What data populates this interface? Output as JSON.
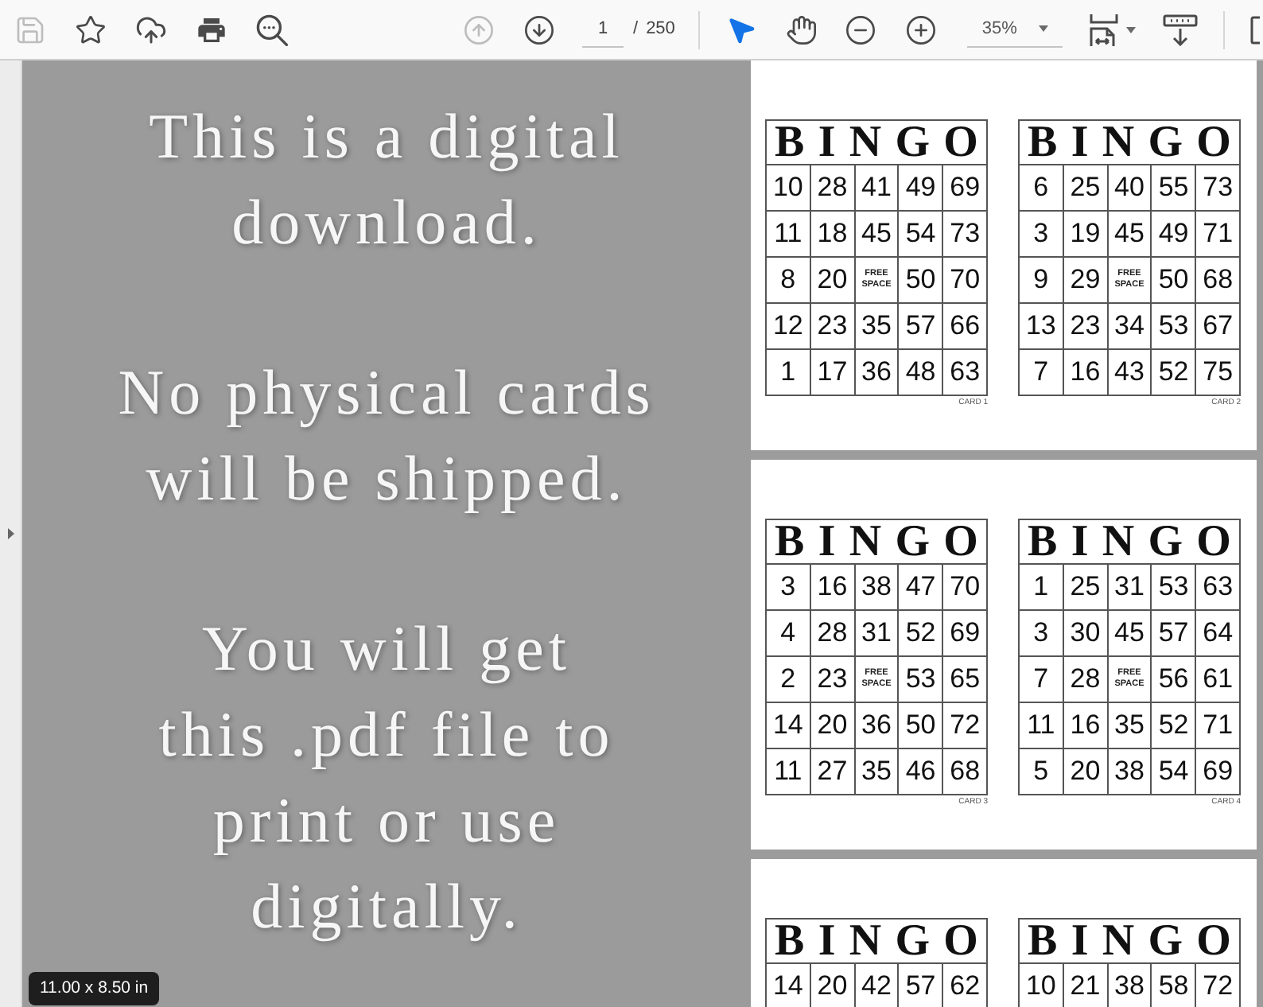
{
  "toolbar": {
    "file_buttons": [
      {
        "kind": "save",
        "disabled": true
      },
      {
        "kind": "bookmark",
        "disabled": false
      },
      {
        "kind": "upload",
        "disabled": false
      },
      {
        "kind": "print",
        "disabled": false
      },
      {
        "kind": "find",
        "disabled": false
      }
    ],
    "page_nav": [
      {
        "kind": "previous",
        "disabled": true
      },
      {
        "kind": "next",
        "disabled": false
      }
    ],
    "page_number": "1",
    "page_separator": "/",
    "page_count": "250",
    "tools": [
      {
        "kind": "select",
        "selected": true
      },
      {
        "kind": "hand",
        "selected": false
      }
    ],
    "zoom_buttons": [
      {
        "kind": "zoom_out"
      },
      {
        "kind": "zoom_in"
      }
    ],
    "zoom_level": "35%",
    "view_buttons": [
      {
        "kind": "fit_page"
      },
      {
        "kind": "scroll_mode"
      }
    ]
  },
  "notice": {
    "paragraphs": [
      {
        "lines": [
          "This is a digital",
          "download."
        ]
      },
      {
        "lines": [
          "No physical cards",
          "will be shipped."
        ]
      },
      {
        "lines": [
          "You will get",
          "this .pdf file to",
          "print or use",
          "digitally."
        ]
      }
    ]
  },
  "page_size": "11.00 x 8.50 in",
  "pages": [
    {
      "cards": [
        {
          "header": [
            "B",
            "I",
            "N",
            "G",
            "O"
          ],
          "rows": [
            [
              {
                "kind": "number",
                "text": "10"
              },
              {
                "kind": "number",
                "text": "28"
              },
              {
                "kind": "number",
                "text": "41"
              },
              {
                "kind": "number",
                "text": "49"
              },
              {
                "kind": "number",
                "text": "69"
              }
            ],
            [
              {
                "kind": "number",
                "text": "11"
              },
              {
                "kind": "number",
                "text": "18"
              },
              {
                "kind": "number",
                "text": "45"
              },
              {
                "kind": "number",
                "text": "54"
              },
              {
                "kind": "number",
                "text": "73"
              }
            ],
            [
              {
                "kind": "number",
                "text": "8"
              },
              {
                "kind": "number",
                "text": "20"
              },
              {
                "kind": "free_space",
                "text": "FREE SPACE"
              },
              {
                "kind": "number",
                "text": "50"
              },
              {
                "kind": "number",
                "text": "70"
              }
            ],
            [
              {
                "kind": "number",
                "text": "12"
              },
              {
                "kind": "number",
                "text": "23"
              },
              {
                "kind": "number",
                "text": "35"
              },
              {
                "kind": "number",
                "text": "57"
              },
              {
                "kind": "number",
                "text": "66"
              }
            ],
            [
              {
                "kind": "number",
                "text": "1"
              },
              {
                "kind": "number",
                "text": "17"
              },
              {
                "kind": "number",
                "text": "36"
              },
              {
                "kind": "number",
                "text": "48"
              },
              {
                "kind": "number",
                "text": "63"
              }
            ]
          ],
          "label": "CARD 1"
        },
        {
          "header": [
            "B",
            "I",
            "N",
            "G",
            "O"
          ],
          "rows": [
            [
              {
                "kind": "number",
                "text": "6"
              },
              {
                "kind": "number",
                "text": "25"
              },
              {
                "kind": "number",
                "text": "40"
              },
              {
                "kind": "number",
                "text": "55"
              },
              {
                "kind": "number",
                "text": "73"
              }
            ],
            [
              {
                "kind": "number",
                "text": "3"
              },
              {
                "kind": "number",
                "text": "19"
              },
              {
                "kind": "number",
                "text": "45"
              },
              {
                "kind": "number",
                "text": "49"
              },
              {
                "kind": "number",
                "text": "71"
              }
            ],
            [
              {
                "kind": "number",
                "text": "9"
              },
              {
                "kind": "number",
                "text": "29"
              },
              {
                "kind": "free_space",
                "text": "FREE SPACE"
              },
              {
                "kind": "number",
                "text": "50"
              },
              {
                "kind": "number",
                "text": "68"
              }
            ],
            [
              {
                "kind": "number",
                "text": "13"
              },
              {
                "kind": "number",
                "text": "23"
              },
              {
                "kind": "number",
                "text": "34"
              },
              {
                "kind": "number",
                "text": "53"
              },
              {
                "kind": "number",
                "text": "67"
              }
            ],
            [
              {
                "kind": "number",
                "text": "7"
              },
              {
                "kind": "number",
                "text": "16"
              },
              {
                "kind": "number",
                "text": "43"
              },
              {
                "kind": "number",
                "text": "52"
              },
              {
                "kind": "number",
                "text": "75"
              }
            ]
          ],
          "label": "CARD 2"
        }
      ]
    },
    {
      "cards": [
        {
          "header": [
            "B",
            "I",
            "N",
            "G",
            "O"
          ],
          "rows": [
            [
              {
                "kind": "number",
                "text": "3"
              },
              {
                "kind": "number",
                "text": "16"
              },
              {
                "kind": "number",
                "text": "38"
              },
              {
                "kind": "number",
                "text": "47"
              },
              {
                "kind": "number",
                "text": "70"
              }
            ],
            [
              {
                "kind": "number",
                "text": "4"
              },
              {
                "kind": "number",
                "text": "28"
              },
              {
                "kind": "number",
                "text": "31"
              },
              {
                "kind": "number",
                "text": "52"
              },
              {
                "kind": "number",
                "text": "69"
              }
            ],
            [
              {
                "kind": "number",
                "text": "2"
              },
              {
                "kind": "number",
                "text": "23"
              },
              {
                "kind": "free_space",
                "text": "FREE SPACE"
              },
              {
                "kind": "number",
                "text": "53"
              },
              {
                "kind": "number",
                "text": "65"
              }
            ],
            [
              {
                "kind": "number",
                "text": "14"
              },
              {
                "kind": "number",
                "text": "20"
              },
              {
                "kind": "number",
                "text": "36"
              },
              {
                "kind": "number",
                "text": "50"
              },
              {
                "kind": "number",
                "text": "72"
              }
            ],
            [
              {
                "kind": "number",
                "text": "11"
              },
              {
                "kind": "number",
                "text": "27"
              },
              {
                "kind": "number",
                "text": "35"
              },
              {
                "kind": "number",
                "text": "46"
              },
              {
                "kind": "number",
                "text": "68"
              }
            ]
          ],
          "label": "CARD 3"
        },
        {
          "header": [
            "B",
            "I",
            "N",
            "G",
            "O"
          ],
          "rows": [
            [
              {
                "kind": "number",
                "text": "1"
              },
              {
                "kind": "number",
                "text": "25"
              },
              {
                "kind": "number",
                "text": "31"
              },
              {
                "kind": "number",
                "text": "53"
              },
              {
                "kind": "number",
                "text": "63"
              }
            ],
            [
              {
                "kind": "number",
                "text": "3"
              },
              {
                "kind": "number",
                "text": "30"
              },
              {
                "kind": "number",
                "text": "45"
              },
              {
                "kind": "number",
                "text": "57"
              },
              {
                "kind": "number",
                "text": "64"
              }
            ],
            [
              {
                "kind": "number",
                "text": "7"
              },
              {
                "kind": "number",
                "text": "28"
              },
              {
                "kind": "free_space",
                "text": "FREE SPACE"
              },
              {
                "kind": "number",
                "text": "56"
              },
              {
                "kind": "number",
                "text": "61"
              }
            ],
            [
              {
                "kind": "number",
                "text": "11"
              },
              {
                "kind": "number",
                "text": "16"
              },
              {
                "kind": "number",
                "text": "35"
              },
              {
                "kind": "number",
                "text": "52"
              },
              {
                "kind": "number",
                "text": "71"
              }
            ],
            [
              {
                "kind": "number",
                "text": "5"
              },
              {
                "kind": "number",
                "text": "20"
              },
              {
                "kind": "number",
                "text": "38"
              },
              {
                "kind": "number",
                "text": "54"
              },
              {
                "kind": "number",
                "text": "69"
              }
            ]
          ],
          "label": "CARD 4"
        }
      ]
    },
    {
      "cards": [
        {
          "header": [
            "B",
            "I",
            "N",
            "G",
            "O"
          ],
          "rows": [
            [
              {
                "kind": "number",
                "text": "14"
              },
              {
                "kind": "number",
                "text": "20"
              },
              {
                "kind": "number",
                "text": "42"
              },
              {
                "kind": "number",
                "text": "57"
              },
              {
                "kind": "number",
                "text": "62"
              }
            ]
          ]
        },
        {
          "header": [
            "B",
            "I",
            "N",
            "G",
            "O"
          ],
          "rows": [
            [
              {
                "kind": "number",
                "text": "10"
              },
              {
                "kind": "number",
                "text": "21"
              },
              {
                "kind": "number",
                "text": "38"
              },
              {
                "kind": "number",
                "text": "58"
              },
              {
                "kind": "number",
                "text": "72"
              }
            ]
          ]
        }
      ]
    }
  ]
}
